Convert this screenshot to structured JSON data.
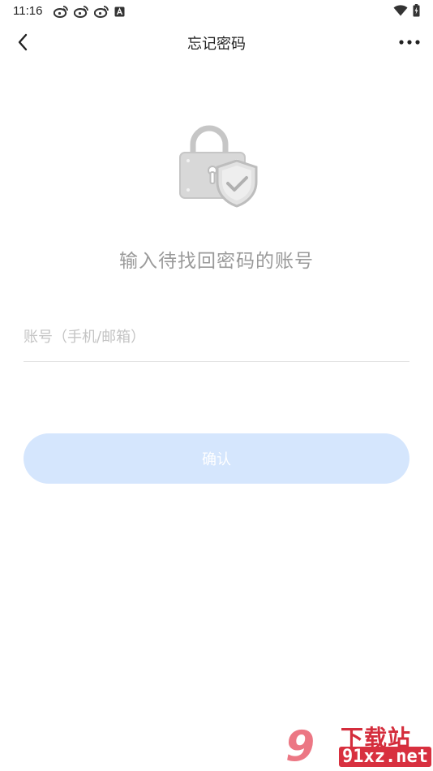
{
  "status_bar": {
    "time": "11:16",
    "left_icons": [
      "weibo-icon",
      "weibo-icon",
      "weibo-icon",
      "a-notification-icon"
    ],
    "right_icons": [
      "wifi-icon",
      "battery-charging-icon"
    ]
  },
  "nav": {
    "title": "忘记密码",
    "back_icon": "chevron-left-icon",
    "more_icon": "more-horizontal-icon"
  },
  "hero": {
    "icon": "lock-shield-icon"
  },
  "prompt": {
    "text": "输入待找回密码的账号"
  },
  "account": {
    "placeholder": "账号（手机/邮箱）",
    "value": ""
  },
  "confirm": {
    "label": "确认",
    "color": "#d5e6fd"
  },
  "watermark": {
    "top": "下载站",
    "bottom": "91xz.net",
    "nine": "9"
  }
}
